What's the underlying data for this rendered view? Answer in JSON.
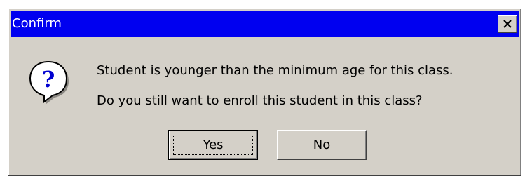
{
  "dialog": {
    "title": "Confirm",
    "close_icon": "close-x-icon",
    "icon": "question-icon",
    "message_line1": "Student is younger than the minimum age for this class.",
    "message_line2": "Do you still want to enroll this student in this class?",
    "buttons": {
      "yes": {
        "mnemonic": "Y",
        "rest": "es",
        "default": true
      },
      "no": {
        "mnemonic": "N",
        "rest": "o",
        "default": false
      }
    }
  },
  "colors": {
    "titlebar": "#0000f0",
    "face": "#d4d0c8",
    "icon_blue": "#0000d0"
  }
}
